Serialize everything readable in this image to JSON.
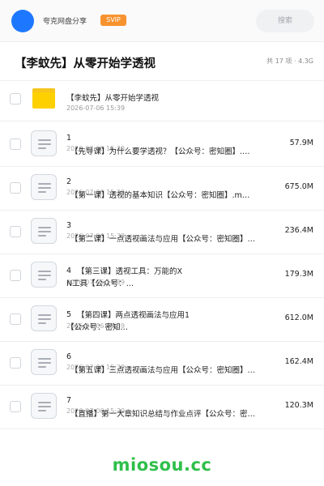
{
  "header": {
    "user_name": "夸克网盘分享",
    "badge": "SVIP",
    "search_placeholder": "搜索"
  },
  "title_bar": {
    "title": "【李蚊先】从零开始学透视",
    "meta": "共 17 项 · 4.3G"
  },
  "folder": {
    "name": "【李蚊先】从零开始学透视",
    "date": "2026-07-06 15:39"
  },
  "files": [
    {
      "num": "1",
      "date": "2026-07-06 15:39",
      "name": "【先导课】为什么要学透视？【公众号：密知圈】.…",
      "size": "57.9M"
    },
    {
      "num": "2",
      "date": "2026-07-06 15:39",
      "name": "【第一课】透视的基本知识【公众号：密知圈】.m…",
      "size": "675.0M"
    },
    {
      "num": "3",
      "date": "2026-07-06 15:39",
      "name": "【第二课】一点透视画法与应用【公众号：密知圈】…",
      "size": "236.4M"
    },
    {
      "num": "4",
      "date": "2026-07-06 15:39",
      "name": "【第三课】透视工具：万能的X",
      "name2": "N工具【公众号：…",
      "size": "179.3M"
    },
    {
      "num": "5",
      "date": "2026-07-06 15:39",
      "name": "【第四课】两点透视画法与应用1",
      "name2": "【公众号：密知…",
      "size": "612.0M"
    },
    {
      "num": "6",
      "date": "2026-07-06 15:39",
      "name": "【第五课】三点透视画法与应用【公众号：密知圈】…",
      "size": "162.4M"
    },
    {
      "num": "7",
      "date": "2026-07-06 15:39",
      "name": "【直播】第一大章知识总结与作业点评【公众号：密…",
      "size": "120.3M"
    }
  ],
  "watermark": "miosou.cc",
  "colors": {
    "accent": "#1e78ff",
    "svip": "#f7932f",
    "folder": "#ffd000",
    "watermark": "#2fbf4a"
  }
}
